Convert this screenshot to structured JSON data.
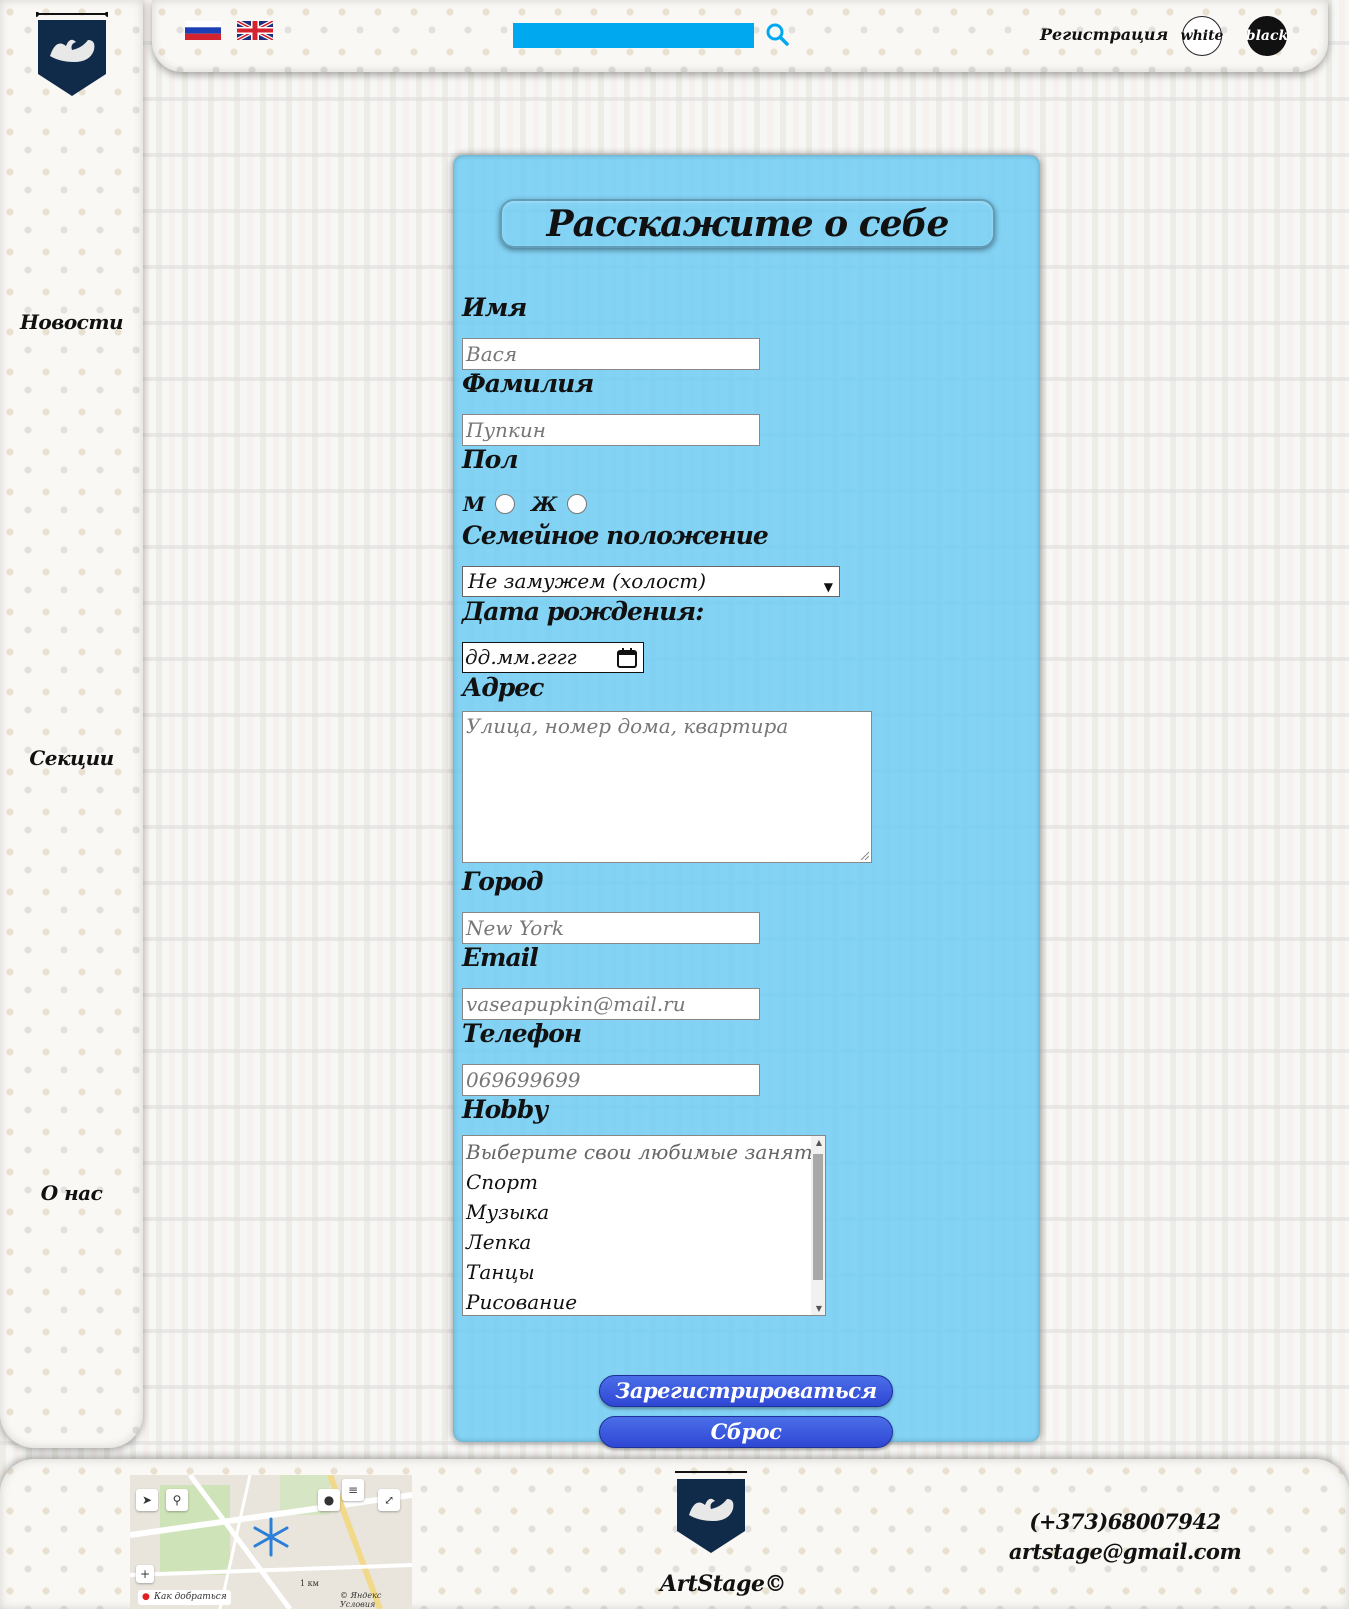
{
  "sidebar": {
    "links": [
      "Новости",
      "Секции",
      "О нас"
    ]
  },
  "header": {
    "search_placeholder": "",
    "register_label": "Регистрация",
    "theme_white_label": "white",
    "theme_black_label": "black",
    "search_color": "#00a8ef"
  },
  "form": {
    "title": "Расскажите о себе",
    "name_label": "Имя",
    "name_placeholder": "Вася",
    "surname_label": "Фамилия",
    "surname_placeholder": "Пупкин",
    "gender_label": "Пол",
    "gender_male": "М",
    "gender_female": "Ж",
    "marital_label": "Семейное положение",
    "marital_value": "Не замужем (холост)",
    "birth_label": "Дата рождения:",
    "birth_placeholder": "дд.мм.гггг",
    "address_label": "Адрес",
    "address_placeholder": "Улица, номер дома, квартира",
    "city_label": "Город",
    "city_placeholder": "New York",
    "email_label": "Email",
    "email_placeholder": "vaseapupkin@mail.ru",
    "phone_label": "Телефон",
    "phone_placeholder": "069699699",
    "hobby_label": "Hobby",
    "hobby_options": [
      "Выберите свои любимые занятия",
      "Спорт",
      "Музыка",
      "Лепка",
      "Танцы",
      "Рисование"
    ],
    "submit_label": "Зарегистрироваться",
    "reset_label": "Сброс",
    "panel_color": "#6ecdf5",
    "button_color": "#3a58e0"
  },
  "footer": {
    "map_route_label": "Как добраться",
    "map_copyright": "© Яндекс Условия",
    "map_scale": "1 км",
    "brand": "ArtStage©",
    "phone": "(+373)68007942",
    "email": "artstage@gmail.com"
  }
}
